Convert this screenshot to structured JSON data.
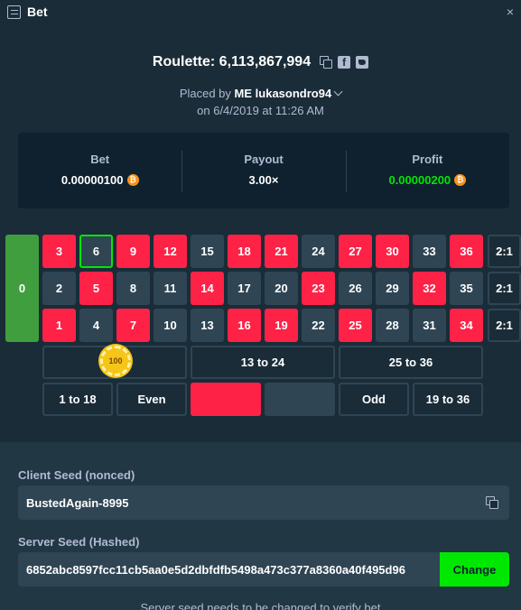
{
  "window": {
    "title": "Bet",
    "close": "×"
  },
  "header": {
    "game_title": "Roulette: 6,113,867,994",
    "placed_prefix": "Placed by",
    "user_badge": "ME",
    "username": "lukasondro94",
    "date": "on 6/4/2019 at 11:26 AM"
  },
  "stats": {
    "bet_label": "Bet",
    "bet_value": "0.00000100",
    "payout_label": "Payout",
    "payout_value": "3.00×",
    "profit_label": "Profit",
    "profit_value": "0.00000200",
    "currency_symbol": "₿"
  },
  "board": {
    "zero": "0",
    "rows": [
      [
        {
          "n": "3",
          "c": "red"
        },
        {
          "n": "6",
          "c": "black",
          "selected": true
        },
        {
          "n": "9",
          "c": "red"
        },
        {
          "n": "12",
          "c": "red"
        },
        {
          "n": "15",
          "c": "black"
        },
        {
          "n": "18",
          "c": "red"
        },
        {
          "n": "21",
          "c": "red"
        },
        {
          "n": "24",
          "c": "black"
        },
        {
          "n": "27",
          "c": "red"
        },
        {
          "n": "30",
          "c": "red"
        },
        {
          "n": "33",
          "c": "black"
        },
        {
          "n": "36",
          "c": "red"
        }
      ],
      [
        {
          "n": "2",
          "c": "black"
        },
        {
          "n": "5",
          "c": "red"
        },
        {
          "n": "8",
          "c": "black"
        },
        {
          "n": "11",
          "c": "black"
        },
        {
          "n": "14",
          "c": "red"
        },
        {
          "n": "17",
          "c": "black"
        },
        {
          "n": "20",
          "c": "black"
        },
        {
          "n": "23",
          "c": "red"
        },
        {
          "n": "26",
          "c": "black"
        },
        {
          "n": "29",
          "c": "black"
        },
        {
          "n": "32",
          "c": "red"
        },
        {
          "n": "35",
          "c": "black"
        }
      ],
      [
        {
          "n": "1",
          "c": "red"
        },
        {
          "n": "4",
          "c": "black"
        },
        {
          "n": "7",
          "c": "red"
        },
        {
          "n": "10",
          "c": "black"
        },
        {
          "n": "13",
          "c": "black"
        },
        {
          "n": "16",
          "c": "red"
        },
        {
          "n": "19",
          "c": "red"
        },
        {
          "n": "22",
          "c": "black"
        },
        {
          "n": "25",
          "c": "red"
        },
        {
          "n": "28",
          "c": "black"
        },
        {
          "n": "31",
          "c": "black"
        },
        {
          "n": "34",
          "c": "red"
        }
      ]
    ],
    "column_bets": [
      "2:1",
      "2:1",
      "2:1"
    ],
    "dozens": [
      "",
      "13 to 24",
      "25 to 36"
    ],
    "outside": [
      "1 to 18",
      "Even",
      "",
      "",
      "Odd",
      "19 to 36"
    ],
    "chip_value": "100"
  },
  "seeds": {
    "client_label": "Client Seed (nonced)",
    "client_value": "BustedAgain-8995",
    "server_label": "Server Seed (Hashed)",
    "server_value": "6852abc8597fcc11cb5aa0e5d2dbfdfb5498a473c377a8360a40f495d96",
    "change_label": "Change",
    "note": "Server seed needs to be changed to verify bet"
  }
}
